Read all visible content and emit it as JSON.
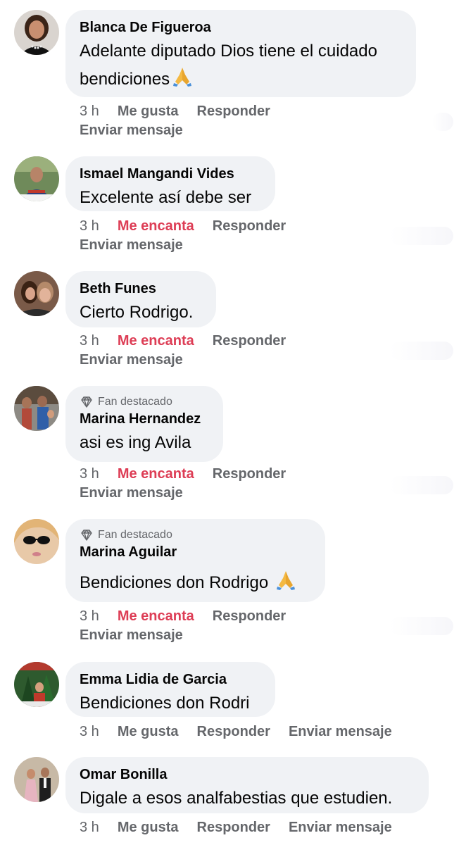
{
  "comments": [
    {
      "author": "Blanca De Figueroa",
      "text": "Adelante diputado Dios tiene el cuidado bendiciones",
      "emoji": "pray",
      "fan": "",
      "time": "3 h",
      "reaction": "Me gusta",
      "reply": "Responder",
      "message": "Enviar mensaje"
    },
    {
      "author": "Ismael Mangandi Vides",
      "text": "Excelente así debe ser",
      "fan": "",
      "time": "3 h",
      "reaction": "Me encanta",
      "reply": "Responder",
      "message": "Enviar mensaje"
    },
    {
      "author": "Beth Funes",
      "text": "Cierto Rodrigo.",
      "fan": "",
      "time": "3 h",
      "reaction": "Me encanta",
      "reply": "Responder",
      "message": "Enviar mensaje"
    },
    {
      "author": "Marina Hernandez",
      "text": "asi es ing Avila",
      "fan": "Fan destacado",
      "time": "3 h",
      "reaction": "Me encanta",
      "reply": "Responder",
      "message": "Enviar mensaje"
    },
    {
      "author": "Marina Aguilar",
      "text": "Bendiciones don Rodrigo",
      "emoji": "pray",
      "fan": "Fan destacado",
      "time": "3 h",
      "reaction": "Me encanta",
      "reply": "Responder",
      "message": "Enviar mensaje"
    },
    {
      "author": "Emma Lidia de Garcia",
      "text": "Bendiciones don Rodri",
      "fan": "",
      "time": "3 h",
      "reaction": "Me gusta",
      "reply": "Responder",
      "message": "Enviar mensaje"
    },
    {
      "author": "Omar Bonilla",
      "text": "Digale a esos analfabestias que estudien.",
      "fan": "",
      "time": "3 h",
      "reaction": "Me gusta",
      "reply": "Responder",
      "message": "Enviar mensaje"
    }
  ],
  "colors": {
    "bubble": "#f0f2f5",
    "meta": "#65676b",
    "love": "#dd3d55"
  }
}
